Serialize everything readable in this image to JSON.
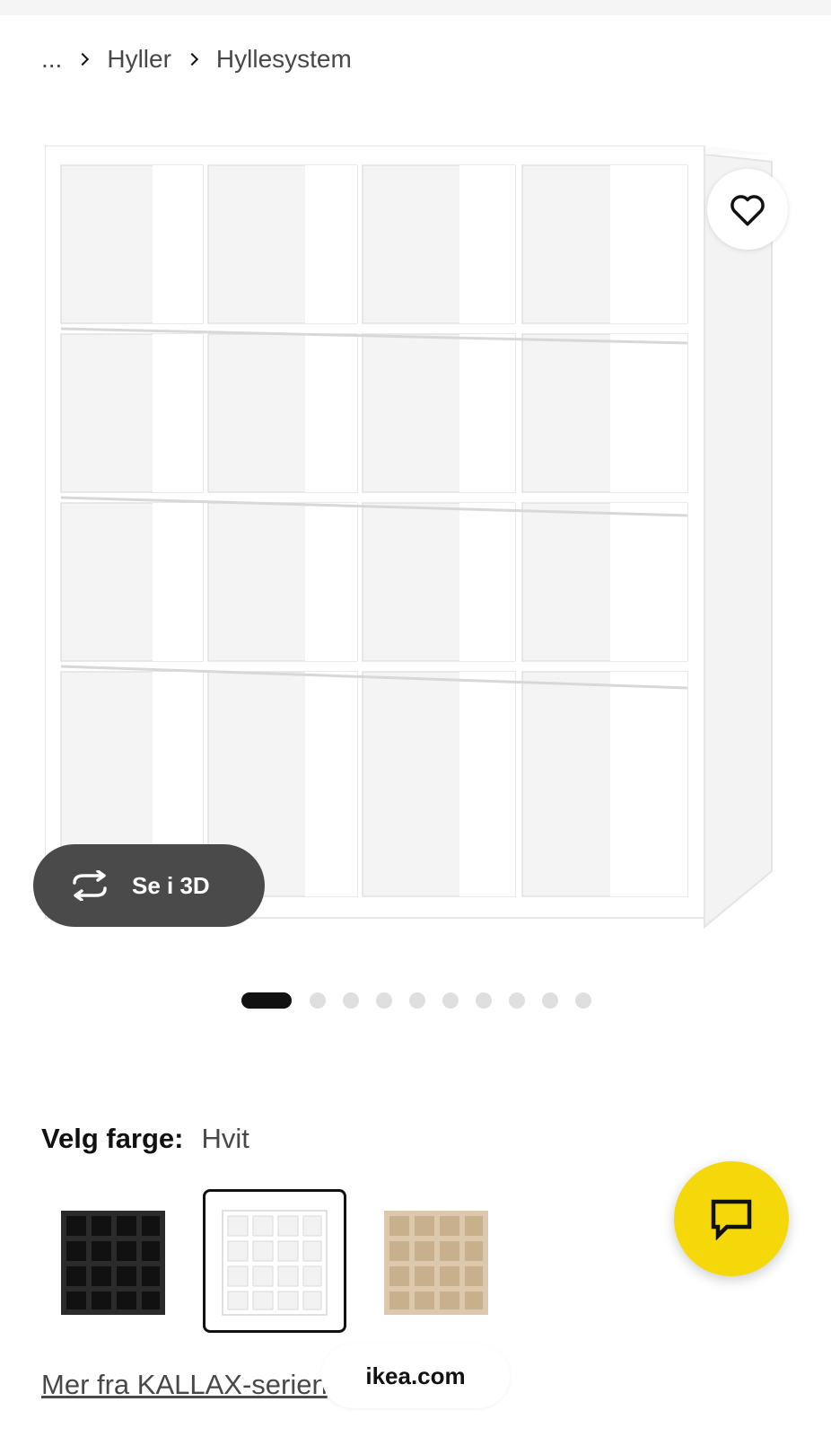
{
  "breadcrumb": {
    "ellipsis": "...",
    "items": [
      {
        "label": "Hyller"
      },
      {
        "label": "Hyllesystem"
      }
    ],
    "separator_icon": "chevron-right-icon"
  },
  "gallery": {
    "favorite_icon": "heart-icon",
    "view_3d_label": "Se i 3D",
    "view_3d_icon": "rotate-arrows-icon",
    "image_count": 10,
    "active_index": 0
  },
  "color": {
    "label": "Velg farge:",
    "selected_value": "Hvit",
    "options": [
      {
        "name": "black-brown",
        "color": "#2b2b2b"
      },
      {
        "name": "white",
        "color": "#ffffff",
        "selected": true
      },
      {
        "name": "white-stained-oak",
        "color": "#dcc8ad"
      }
    ]
  },
  "series_link": "Mer fra KALLAX-serien",
  "site_pill": "ikea.com",
  "chat": {
    "icon": "chat-bubble-icon",
    "color": "#f5d80a"
  },
  "colors": {
    "text": "#111111",
    "muted": "#484848",
    "pill_dark": "#4a4a4a",
    "accent_yellow": "#f5d80a"
  }
}
